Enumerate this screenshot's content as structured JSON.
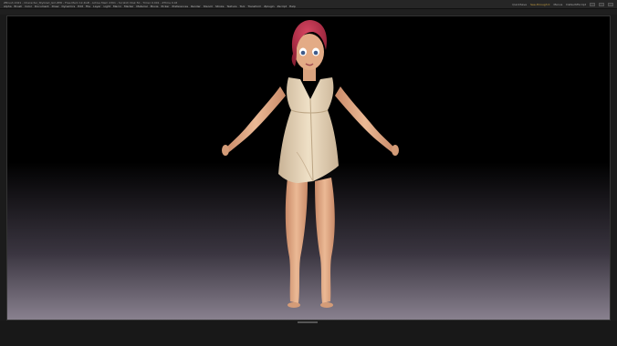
{
  "app": {
    "title": "ZBrush 2021 - Character_Stylized_Girl.ZPR - Free Mem 12.4GB - Active Mem 2301 - Scratch Disk 50 - Timer 0.001 - ZTime 0.045 - PolyCount 1.2 MP - MeshCount 14"
  },
  "menubar": {
    "items": [
      "Alpha",
      "Brush",
      "Color",
      "Document",
      "Draw",
      "Dynamics",
      "Edit",
      "File",
      "Layer",
      "Light",
      "Macro",
      "Marker",
      "Material",
      "Movie",
      "Picker",
      "Preferences",
      "Render",
      "Stencil",
      "Stroke",
      "Texture",
      "Tool",
      "Transform",
      "Zplugin",
      "Zscript",
      "Help"
    ]
  },
  "right_cluster": {
    "quicksave": "QuickSave",
    "see_through": "See-through 0",
    "menus": "Menus",
    "script": "DefaultZScript"
  },
  "viewport": {
    "label": ""
  },
  "colors": {
    "bg": "#1b1b1b",
    "skin": "#e8b48c",
    "dress": "#e6d3b6",
    "hair": "#c2334f"
  }
}
